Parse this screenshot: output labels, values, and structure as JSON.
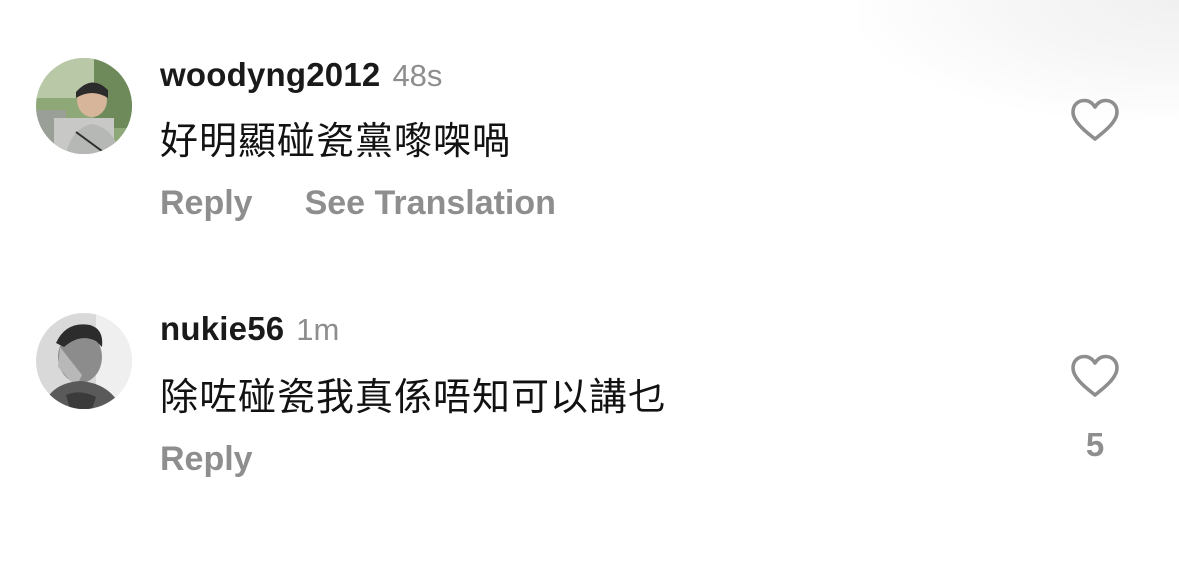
{
  "comments": [
    {
      "username": "woodyng2012",
      "time": "48s",
      "text": "好明顯碰瓷黨嚟㗎喎",
      "actions": [
        "Reply",
        "See Translation"
      ],
      "like_count": ""
    },
    {
      "username": "nukie56",
      "time": "1m",
      "text": "除咗碰瓷我真係唔知可以講乜",
      "actions": [
        "Reply"
      ],
      "like_count": "5"
    }
  ],
  "icons": {
    "like": "heart-outline-icon"
  },
  "colors": {
    "background": "#ffffff",
    "username": "#1a1a1a",
    "secondary": "#8e8e8e",
    "body_text": "#121212"
  }
}
